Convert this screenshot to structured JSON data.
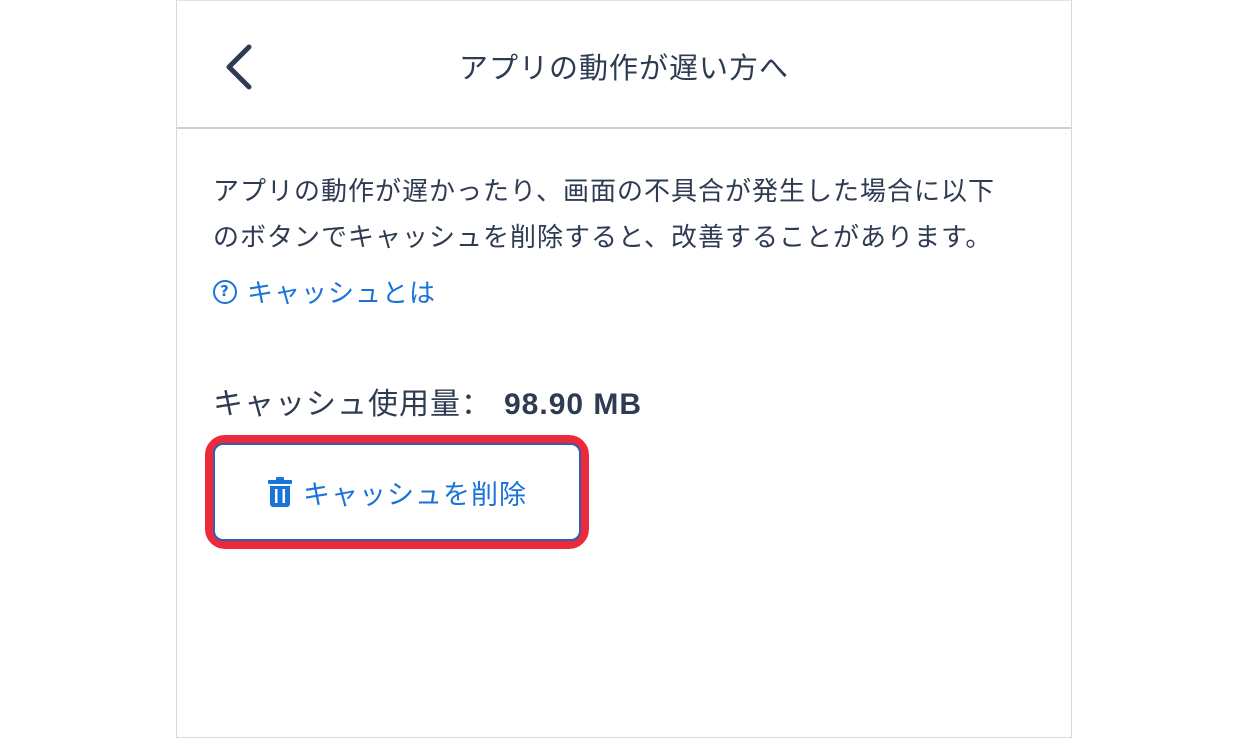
{
  "header": {
    "title": "アプリの動作が遅い方へ",
    "back_icon": "chevron-left-icon"
  },
  "main": {
    "description_line1": "アプリの動作が遅かったり、画面の不具合が発生した場合に以下",
    "description_line2": "のボタンでキャッシュを削除すると、改善することがあります。",
    "help_icon": "question-circle-icon",
    "help_link_label": "キャッシュとは",
    "usage_label": "キャッシュ使用量：",
    "usage_value": "98.90 MB",
    "delete_button_icon": "trash-icon",
    "delete_button_label": "キャッシュを削除"
  },
  "colors": {
    "text": "#2f3b52",
    "link": "#1a73d9",
    "button_border": "#2e5fb0",
    "highlight": "#ec2a3c",
    "divider": "#cfcfcf"
  }
}
